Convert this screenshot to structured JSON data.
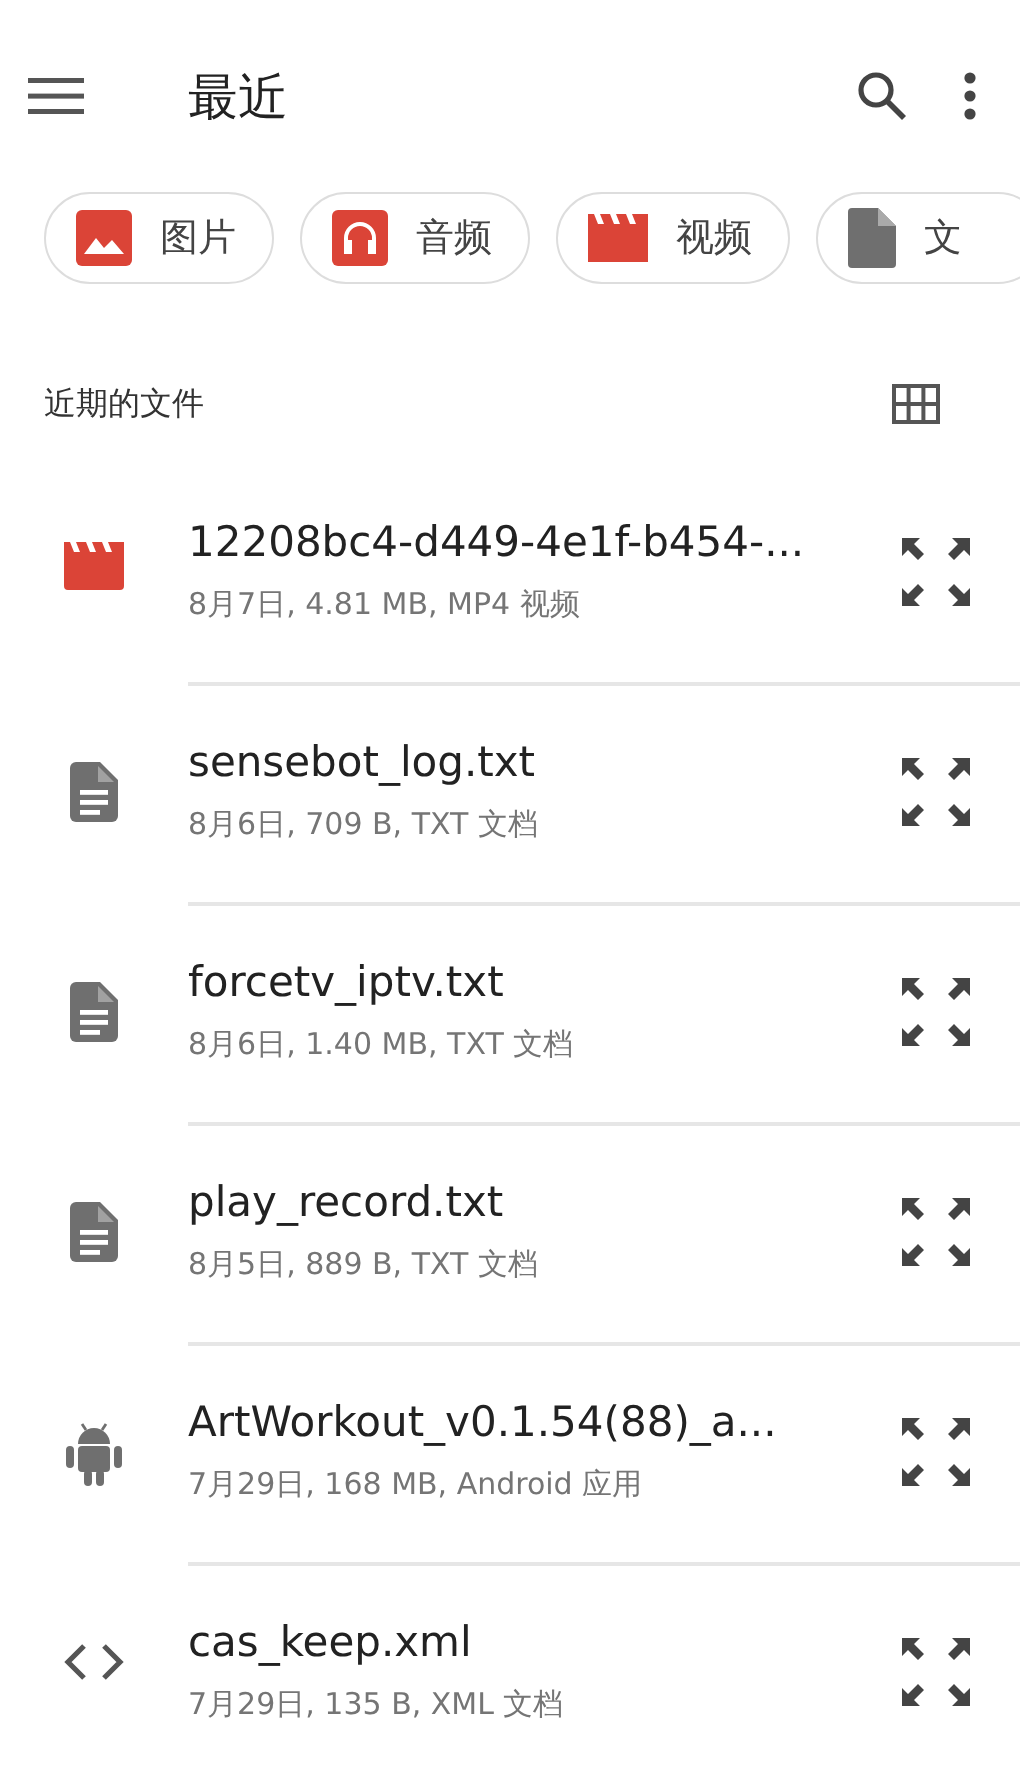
{
  "app_bar": {
    "title": "最近"
  },
  "chips": [
    {
      "label": "图片",
      "kind": "image"
    },
    {
      "label": "音频",
      "kind": "audio"
    },
    {
      "label": "视频",
      "kind": "video"
    },
    {
      "label": "文",
      "kind": "document"
    }
  ],
  "section": {
    "title": "近期的文件"
  },
  "files": [
    {
      "kind": "video",
      "name": "12208bc4-d449-4e1f-b454-...",
      "details": "8月7日, 4.81 MB, MP4 视频"
    },
    {
      "kind": "text",
      "name": "sensebot_log.txt",
      "details": "8月6日, 709 B, TXT 文档"
    },
    {
      "kind": "text",
      "name": "forcetv_iptv.txt",
      "details": "8月6日, 1.40 MB, TXT 文档"
    },
    {
      "kind": "text",
      "name": "play_record.txt",
      "details": "8月5日, 889 B, TXT 文档"
    },
    {
      "kind": "android",
      "name": "ArtWorkout_v0.1.54(88)_a...",
      "details": "7月29日, 168 MB, Android 应用"
    },
    {
      "kind": "code",
      "name": "cas_keep.xml",
      "details": "7月29日, 135 B, XML 文档"
    }
  ]
}
